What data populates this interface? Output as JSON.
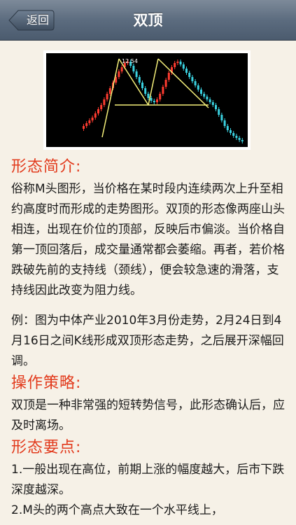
{
  "navbar": {
    "back_label": "返回",
    "title": "双顶"
  },
  "chart_image": {
    "peak_label": "12.54",
    "colors": {
      "up": "#ff3b30",
      "down": "#3ad1e0",
      "trend": "#f5f07a",
      "background": "#000000"
    }
  },
  "sections": [
    {
      "heading": "形态简介:",
      "paragraphs": [
        "俗称M头图形，当价格在某时段内连续两次上升至相约高度时而形成的走势图形。双顶的形态像两座山头相连，出现在价位的顶部，反映后市偏淡。当价格自第一顶回落后，成交量通常都会萎缩。再者，若价格跌破先前的支持线（颈线），便会较急速的滑落，支持线因此改变为阻力线。",
        "例：图为中体产业2010年3月份走势，2月24日到4月16日之间K线形成双顶形态走势，之后展开深幅回调。"
      ]
    },
    {
      "heading": "操作策略:",
      "paragraphs": [
        "双顶是一种非常强的短转势信号，此形态确认后，应及时离场。"
      ]
    },
    {
      "heading": "形态要点:",
      "paragraphs": [
        "1.一般出现在高位，前期上涨的幅度越大，后市下跌深度越深。",
        "2.M头的两个高点大致在一个水平线上，"
      ]
    }
  ]
}
